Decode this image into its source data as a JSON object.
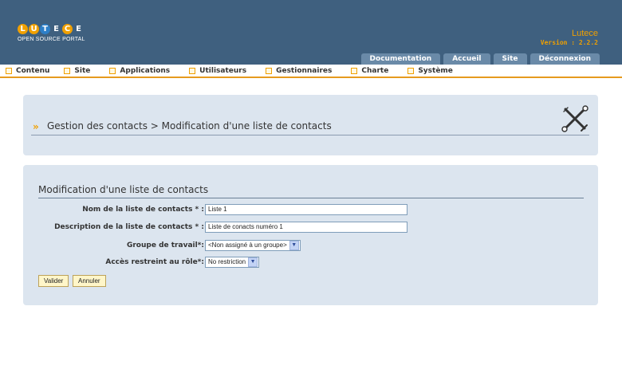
{
  "header": {
    "logo_letters": [
      "L",
      "U",
      "T",
      "E",
      "C",
      "E"
    ],
    "logo_subtitle": "OPEN SOURCE PORTAL",
    "app_title": "Lutece",
    "version": "Version : 2.2.2",
    "tabs": [
      "Documentation",
      "Accueil",
      "Site",
      "Déconnexion"
    ]
  },
  "menu": {
    "items": [
      "Contenu",
      "Site",
      "Applications",
      "Utilisateurs",
      "Gestionnaires",
      "Charte",
      "Système"
    ]
  },
  "title_panel": {
    "breadcrumb": "Gestion des contacts  > Modification d'une liste de contacts",
    "tools_icon": "tools-icon"
  },
  "form": {
    "title": "Modification d'une liste de contacts",
    "fields": {
      "name_label": "Nom de la liste de contacts * :",
      "name_value": "Liste 1",
      "description_label": "Description de la liste de contacts * :",
      "description_value": "Liste de conacts numéro 1",
      "workgroup_label": "Groupe de travail*:",
      "workgroup_value": "<Non assigné à un groupe>",
      "role_label": "Accès restreint au rôle*:",
      "role_value": "No restriction"
    },
    "buttons": {
      "validate": "Valider",
      "cancel": "Annuler"
    }
  },
  "colors": {
    "header_bg": "#3f607f",
    "accent": "#f0a000",
    "panel_bg": "#dce5ef"
  }
}
